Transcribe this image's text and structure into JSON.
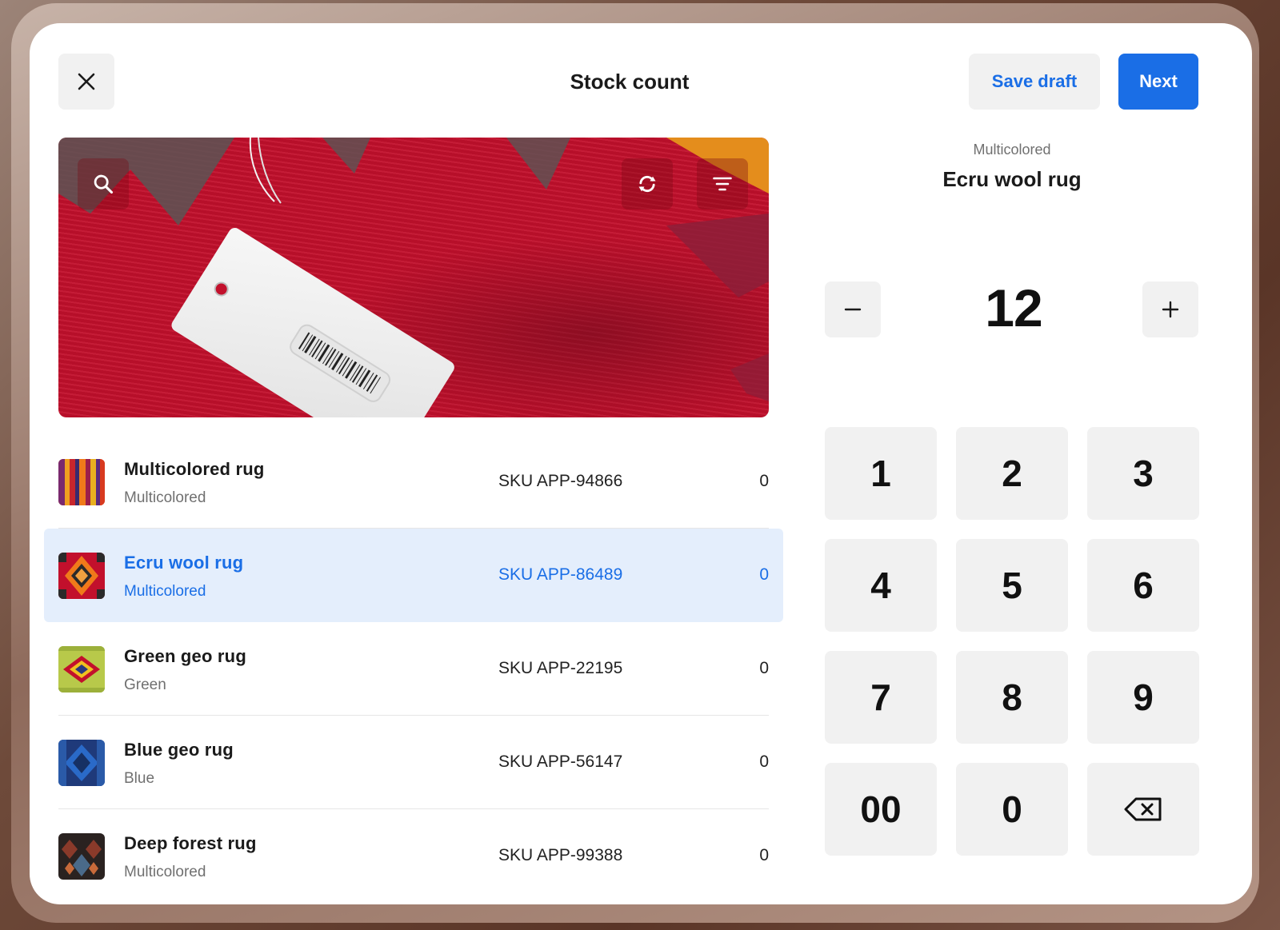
{
  "header": {
    "title": "Stock count",
    "close_icon": "close-icon",
    "save_draft_label": "Save draft",
    "next_label": "Next"
  },
  "scanner": {
    "search_icon": "search-icon",
    "switch_camera_icon": "switch-camera-icon",
    "filter_icon": "filter-icon"
  },
  "products": [
    {
      "name": "Multicolored rug",
      "variant": "Multicolored",
      "sku": "SKU APP-94866",
      "count": "0",
      "selected": false
    },
    {
      "name": "Ecru wool rug",
      "variant": "Multicolored",
      "sku": "SKU APP-86489",
      "count": "0",
      "selected": true
    },
    {
      "name": "Green geo rug",
      "variant": "Green",
      "sku": "SKU APP-22195",
      "count": "0",
      "selected": false
    },
    {
      "name": "Blue geo rug",
      "variant": "Blue",
      "sku": "SKU APP-56147",
      "count": "0",
      "selected": false
    },
    {
      "name": "Deep forest rug",
      "variant": "Multicolored",
      "sku": "SKU APP-99388",
      "count": "0",
      "selected": false
    }
  ],
  "selection": {
    "variant": "Multicolored",
    "name": "Ecru wool rug",
    "count": "12",
    "decrement_icon": "minus-icon",
    "increment_icon": "plus-icon"
  },
  "keypad": {
    "keys": [
      "1",
      "2",
      "3",
      "4",
      "5",
      "6",
      "7",
      "8",
      "9",
      "00",
      "0"
    ],
    "backspace_icon": "backspace-icon"
  },
  "colors": {
    "accent": "#1a6ee6",
    "selected_row_bg": "#e4eefc",
    "button_bg": "#f1f1f1"
  }
}
